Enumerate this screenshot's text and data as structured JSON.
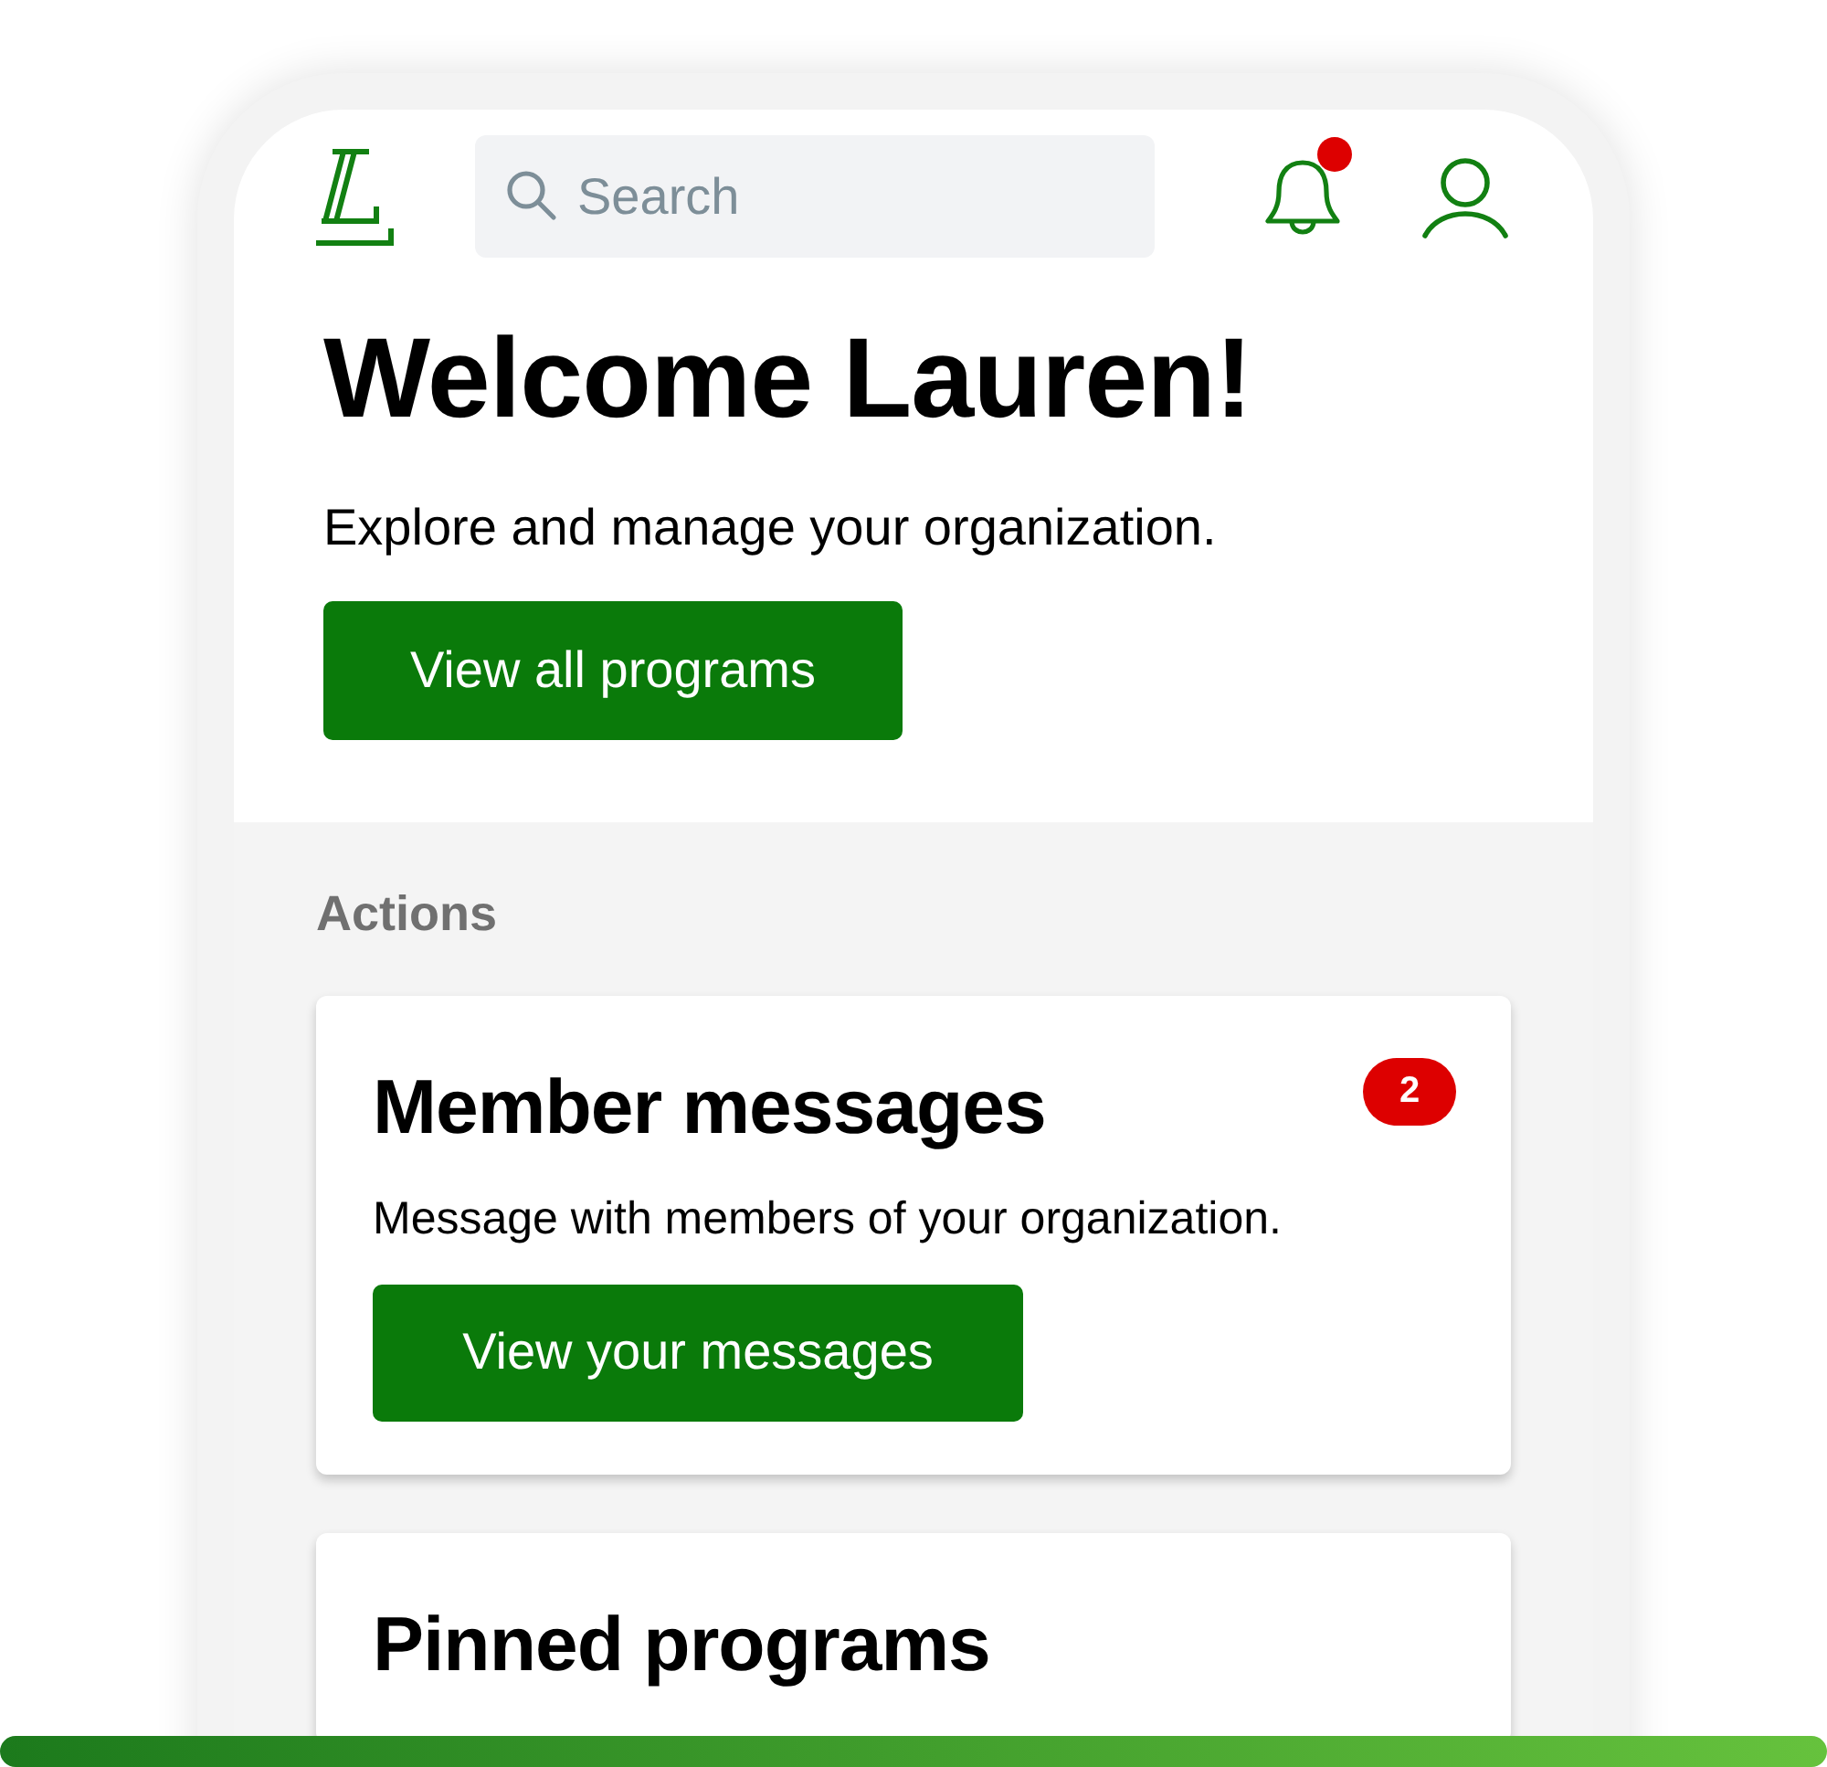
{
  "header": {
    "search": {
      "placeholder": "Search"
    },
    "notifications": {
      "unread": true
    }
  },
  "welcome": {
    "title": "Welcome Lauren!",
    "subtitle": "Explore and manage your organization.",
    "button": "View all programs"
  },
  "section_label": "Actions",
  "cards": [
    {
      "title": "Member messages",
      "badge": "2",
      "text": "Message with members of your organization.",
      "button": "View your messages"
    },
    {
      "title": "Pinned programs"
    }
  ]
}
